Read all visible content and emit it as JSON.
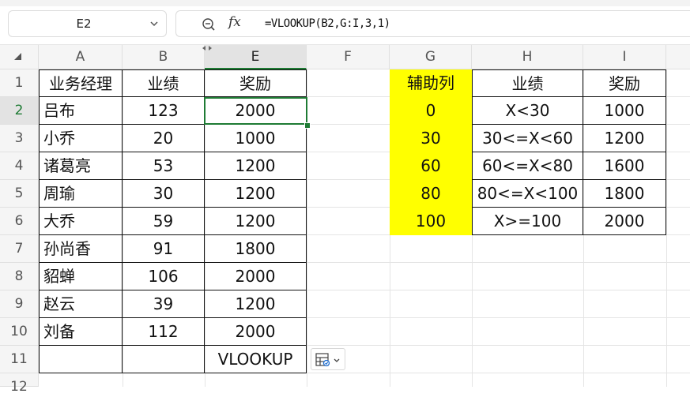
{
  "name_box": {
    "value": "E2"
  },
  "formula_bar": {
    "fx_label": "fx",
    "formula": "=VLOOKUP(B2,G:I,3,1)"
  },
  "columns": [
    "A",
    "B",
    "E",
    "F",
    "G",
    "H",
    "I"
  ],
  "rows": [
    "1",
    "2",
    "3",
    "4",
    "5",
    "6",
    "7",
    "8",
    "9",
    "10",
    "11",
    "12"
  ],
  "table1": {
    "headers": [
      "业务经理",
      "业绩",
      "奖励"
    ],
    "rows": [
      [
        "吕布",
        "123",
        "2000"
      ],
      [
        "小乔",
        "20",
        "1000"
      ],
      [
        "诸葛亮",
        "53",
        "1200"
      ],
      [
        "周瑜",
        "30",
        "1200"
      ],
      [
        "大乔",
        "59",
        "1200"
      ],
      [
        "孙尚香",
        "91",
        "1800"
      ],
      [
        "貂蝉",
        "106",
        "2000"
      ],
      [
        "赵云",
        "39",
        "1200"
      ],
      [
        "刘备",
        "112",
        "2000"
      ]
    ],
    "footer": [
      "",
      "",
      "VLOOKUP"
    ]
  },
  "table2": {
    "headers": [
      "辅助列",
      "业绩",
      "奖励"
    ],
    "rows": [
      [
        "0",
        "X<30",
        "1000"
      ],
      [
        "30",
        "30<=X<60",
        "1200"
      ],
      [
        "60",
        "60<=X<80",
        "1600"
      ],
      [
        "80",
        "80<=X<100",
        "1800"
      ],
      [
        "100",
        "X>=100",
        "2000"
      ]
    ],
    "highlight_color": "#ffff00"
  },
  "selection": {
    "accent": "#1e7b34"
  },
  "icons": {
    "name_dropdown": "chevron-down-icon",
    "zoom": "zoom-icon",
    "quick_analysis": "quick-analysis-icon"
  }
}
